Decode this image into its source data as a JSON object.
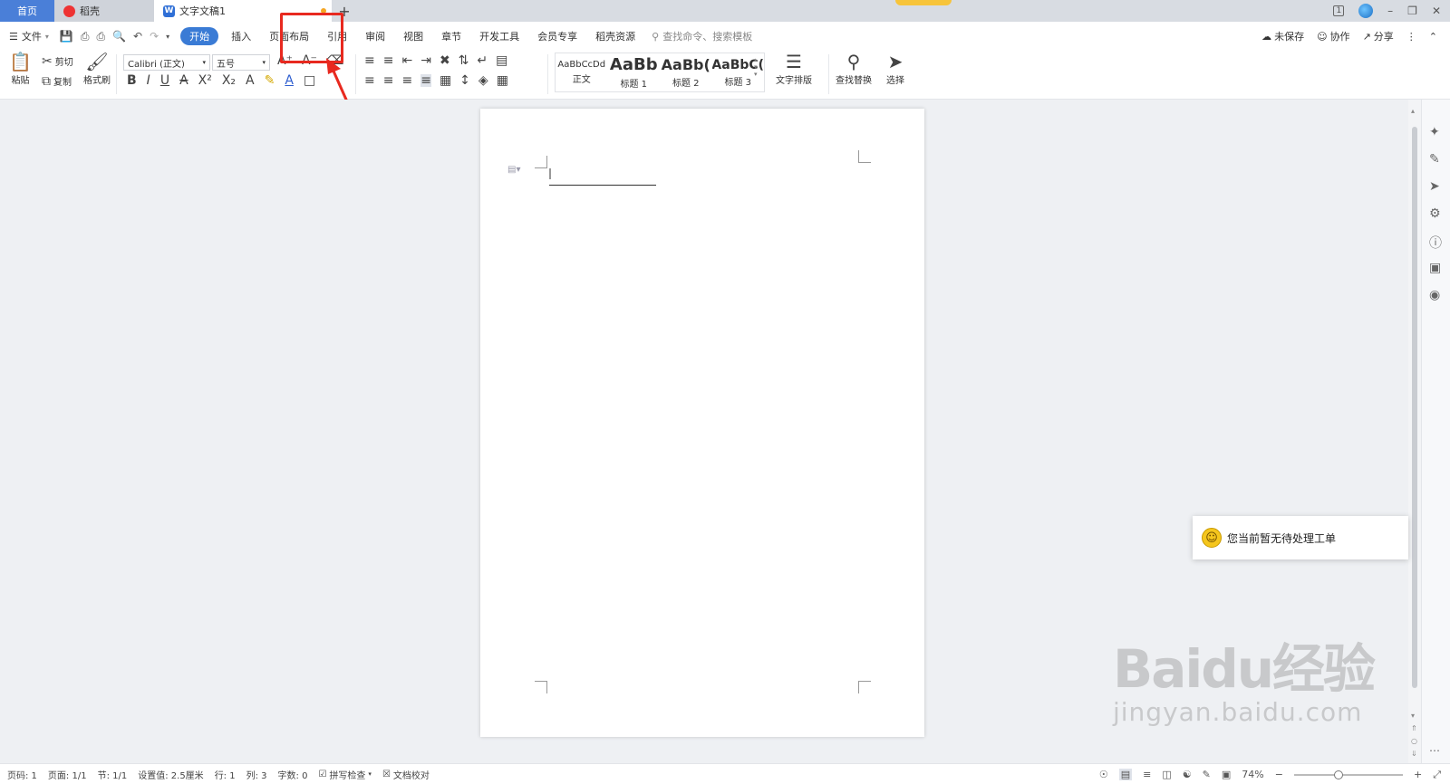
{
  "titlebar": {
    "tabs": [
      {
        "label": "首页",
        "icon": "none"
      },
      {
        "label": "稻壳",
        "icon": "docer-logo-icon"
      },
      {
        "label": "文字文稿1",
        "icon": "writer-doc-icon"
      }
    ],
    "add_tab": "+",
    "window_badge": "1"
  },
  "menubar": {
    "file_label": "文件",
    "tabs": [
      "开始",
      "插入",
      "页面布局",
      "引用",
      "审阅",
      "视图",
      "章节",
      "开发工具",
      "会员专享",
      "稻壳资源"
    ],
    "active_tab": "开始",
    "highlighted_tab": "页面布局",
    "search_placeholder": "查找命令、搜索模板",
    "right": {
      "unsaved": "未保存",
      "collab": "协作",
      "share": "分享"
    }
  },
  "ribbon": {
    "paste": "粘贴",
    "cut": "剪切",
    "copy": "复制",
    "format_painter": "格式刷",
    "font_name": "Calibri (正文)",
    "font_size": "五号",
    "styles": [
      {
        "preview": "AaBbCcDd",
        "name": "正文"
      },
      {
        "preview": "AaBb",
        "name": "标题 1"
      },
      {
        "preview": "AaBb(",
        "name": "标题 2"
      },
      {
        "preview": "AaBbC(",
        "name": "标题 3"
      }
    ],
    "text_layout": "文字排版",
    "find_replace": "查找替换",
    "select": "选择"
  },
  "toast": {
    "message": "您当前暂无待处理工单"
  },
  "watermark": {
    "logo": "Baidu经验",
    "sub": "jingyan.baidu.com"
  },
  "statusbar": {
    "page_num": "页码: 1",
    "pages": "页面: 1/1",
    "section": "节: 1/1",
    "setting": "设置值: 2.5厘米",
    "row": "行: 1",
    "col": "列: 3",
    "word_count": "字数: 0",
    "spell_check": "拼写检查",
    "doc_proof": "文档校对",
    "zoom": "74%",
    "zoom_fraction": 0.74
  },
  "colors": {
    "accent": "#3a7bd5",
    "home_tab": "#4a7fd8",
    "highlight": "#e8291f"
  }
}
